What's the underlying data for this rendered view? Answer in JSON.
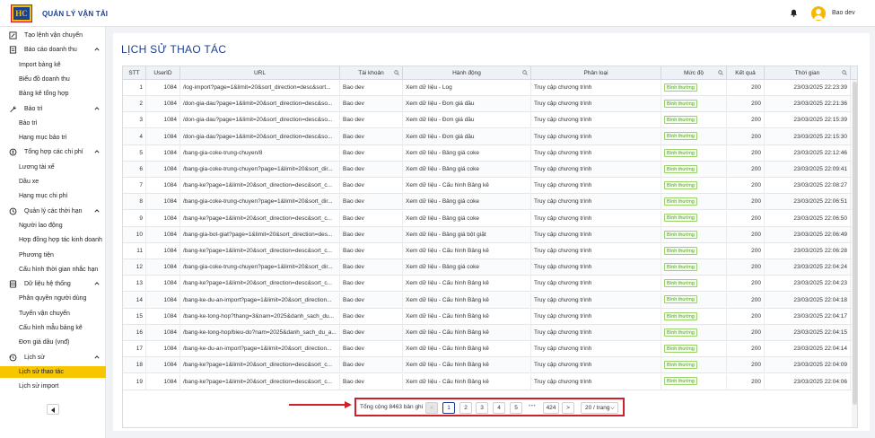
{
  "app": {
    "title": "QUẢN LÝ VẬN TẢI",
    "logo_text": "HC",
    "user_name": "Bao dev"
  },
  "sidebar": {
    "items": [
      {
        "type": "group",
        "label": "Tạo lệnh vận chuyển",
        "icon": "pencil-square-icon",
        "chevron": false
      },
      {
        "type": "group",
        "label": "Báo cáo doanh thu",
        "icon": "report-icon",
        "chevron": true
      },
      {
        "type": "item",
        "label": "Import bảng kê"
      },
      {
        "type": "item",
        "label": "Biểu đồ doanh thu"
      },
      {
        "type": "item",
        "label": "Bảng kê tổng hợp"
      },
      {
        "type": "group",
        "label": "Bảo trì",
        "icon": "wrench-icon",
        "chevron": true
      },
      {
        "type": "item",
        "label": "Bảo trì"
      },
      {
        "type": "item",
        "label": "Hạng mục bảo trì"
      },
      {
        "type": "group",
        "label": "Tổng hợp các chi phí",
        "icon": "coin-icon",
        "chevron": true
      },
      {
        "type": "item",
        "label": "Lương tài xế"
      },
      {
        "type": "item",
        "label": "Dầu xe"
      },
      {
        "type": "item",
        "label": "Hạng mục chi phí"
      },
      {
        "type": "group",
        "label": "Quản lý các thời hạn",
        "icon": "clock-icon",
        "chevron": true
      },
      {
        "type": "item",
        "label": "Người lao động"
      },
      {
        "type": "item",
        "label": "Hợp đồng hợp tác kinh doanh"
      },
      {
        "type": "item",
        "label": "Phương tiện"
      },
      {
        "type": "item",
        "label": "Cấu hình thời gian nhắc hạn"
      },
      {
        "type": "group",
        "label": "Dữ liệu hệ thống",
        "icon": "database-icon",
        "chevron": true
      },
      {
        "type": "item",
        "label": "Phân quyền người dùng"
      },
      {
        "type": "item",
        "label": "Tuyến vận chuyển"
      },
      {
        "type": "item",
        "label": "Cấu hình mẫu bảng kê"
      },
      {
        "type": "item",
        "label": "Đơn giá dầu (vnđ)"
      },
      {
        "type": "group",
        "label": "Lịch sử",
        "icon": "history-icon",
        "chevron": true
      },
      {
        "type": "item",
        "label": "Lịch sử thao tác",
        "active": true
      },
      {
        "type": "item",
        "label": "Lịch sử import"
      }
    ]
  },
  "page": {
    "title": "LỊCH SỬ THAO TÁC"
  },
  "table": {
    "columns": [
      {
        "label": "STT",
        "filter": false
      },
      {
        "label": "UserID",
        "filter": false
      },
      {
        "label": "URL",
        "filter": false
      },
      {
        "label": "Tài khoản",
        "filter": true
      },
      {
        "label": "Hành động",
        "filter": true
      },
      {
        "label": "Phân loại",
        "filter": false
      },
      {
        "label": "Mức độ",
        "filter": true
      },
      {
        "label": "Kết quả",
        "filter": false
      },
      {
        "label": "Thời gian",
        "filter": true
      }
    ],
    "badge_color": "#52a31e",
    "rows": [
      [
        "1",
        "1084",
        "/log-import?page=1&limit=20&sort_direction=desc&sort...",
        "Bao dev",
        "Xem dữ liệu - Log",
        "Truy cập chương trình",
        "Bình thường",
        "200",
        "23/03/2025 22:23:39"
      ],
      [
        "2",
        "1084",
        "/don-gia-dau?page=1&limit=20&sort_direction=desc&so...",
        "Bao dev",
        "Xem dữ liệu - Đơn giá dầu",
        "Truy cập chương trình",
        "Bình thường",
        "200",
        "23/03/2025 22:21:36"
      ],
      [
        "3",
        "1084",
        "/don-gia-dau?page=1&limit=20&sort_direction=desc&so...",
        "Bao dev",
        "Xem dữ liệu - Đơn giá dầu",
        "Truy cập chương trình",
        "Bình thường",
        "200",
        "23/03/2025 22:15:39"
      ],
      [
        "4",
        "1084",
        "/don-gia-dau?page=1&limit=20&sort_direction=desc&so...",
        "Bao dev",
        "Xem dữ liệu - Đơn giá dầu",
        "Truy cập chương trình",
        "Bình thường",
        "200",
        "23/03/2025 22:15:30"
      ],
      [
        "5",
        "1084",
        "/bang-gia-coke-trung-chuyen/8",
        "Bao dev",
        "Xem dữ liệu - Bảng giá coke",
        "Truy cập chương trình",
        "Bình thường",
        "200",
        "23/03/2025 22:12:46"
      ],
      [
        "6",
        "1084",
        "/bang-gia-coke-trung-chuyen?page=1&limit=20&sort_dir...",
        "Bao dev",
        "Xem dữ liệu - Bảng giá coke",
        "Truy cập chương trình",
        "Bình thường",
        "200",
        "23/03/2025 22:09:41"
      ],
      [
        "7",
        "1084",
        "/bang-ke?page=1&limit=20&sort_direction=desc&sort_c...",
        "Bao dev",
        "Xem dữ liệu - Cấu hình Bảng kê",
        "Truy cập chương trình",
        "Bình thường",
        "200",
        "23/03/2025 22:08:27"
      ],
      [
        "8",
        "1084",
        "/bang-gia-coke-trung-chuyen?page=1&limit=20&sort_dir...",
        "Bao dev",
        "Xem dữ liệu - Bảng giá coke",
        "Truy cập chương trình",
        "Bình thường",
        "200",
        "23/03/2025 22:06:51"
      ],
      [
        "9",
        "1084",
        "/bang-ke?page=1&limit=20&sort_direction=desc&sort_c...",
        "Bao dev",
        "Xem dữ liệu - Bảng giá coke",
        "Truy cập chương trình",
        "Bình thường",
        "200",
        "23/03/2025 22:06:50"
      ],
      [
        "10",
        "1084",
        "/bang-gia-bot-giat?page=1&limit=20&sort_direction=des...",
        "Bao dev",
        "Xem dữ liệu - Bảng giá bột giặt",
        "Truy cập chương trình",
        "Bình thường",
        "200",
        "23/03/2025 22:06:49"
      ],
      [
        "11",
        "1084",
        "/bang-ke?page=1&limit=20&sort_direction=desc&sort_c...",
        "Bao dev",
        "Xem dữ liệu - Cấu hình Bảng kê",
        "Truy cập chương trình",
        "Bình thường",
        "200",
        "23/03/2025 22:06:28"
      ],
      [
        "12",
        "1084",
        "/bang-gia-coke-trung-chuyen?page=1&limit=20&sort_dir...",
        "Bao dev",
        "Xem dữ liệu - Bảng giá coke",
        "Truy cập chương trình",
        "Bình thường",
        "200",
        "23/03/2025 22:04:24"
      ],
      [
        "13",
        "1084",
        "/bang-ke?page=1&limit=20&sort_direction=desc&sort_c...",
        "Bao dev",
        "Xem dữ liệu - Cấu hình Bảng kê",
        "Truy cập chương trình",
        "Bình thường",
        "200",
        "23/03/2025 22:04:23"
      ],
      [
        "14",
        "1084",
        "/bang-ke-du-an-import?page=1&limit=20&sort_direction...",
        "Bao dev",
        "Xem dữ liệu - Cấu hình Bảng kê",
        "Truy cập chương trình",
        "Bình thường",
        "200",
        "23/03/2025 22:04:18"
      ],
      [
        "15",
        "1084",
        "/bang-ke-tong-hop?thang=3&nam=2025&danh_sach_du...",
        "Bao dev",
        "Xem dữ liệu - Cấu hình Bảng kê",
        "Truy cập chương trình",
        "Bình thường",
        "200",
        "23/03/2025 22:04:17"
      ],
      [
        "16",
        "1084",
        "/bang-ke-tong-hop/bieu-do?nam=2025&danh_sach_du_a...",
        "Bao dev",
        "Xem dữ liệu - Cấu hình Bảng kê",
        "Truy cập chương trình",
        "Bình thường",
        "200",
        "23/03/2025 22:04:15"
      ],
      [
        "17",
        "1084",
        "/bang-ke-du-an-import?page=1&limit=20&sort_direction...",
        "Bao dev",
        "Xem dữ liệu - Cấu hình Bảng kê",
        "Truy cập chương trình",
        "Bình thường",
        "200",
        "23/03/2025 22:04:14"
      ],
      [
        "18",
        "1084",
        "/bang-ke?page=1&limit=20&sort_direction=desc&sort_c...",
        "Bao dev",
        "Xem dữ liệu - Cấu hình Bảng kê",
        "Truy cập chương trình",
        "Bình thường",
        "200",
        "23/03/2025 22:04:09"
      ],
      [
        "19",
        "1084",
        "/bang-ke?page=1&limit=20&sort_direction=desc&sort_c...",
        "Bao dev",
        "Xem dữ liệu - Cấu hình Bảng kê",
        "Truy cập chương trình",
        "Bình thường",
        "200",
        "23/03/2025 22:04:06"
      ]
    ]
  },
  "pagination": {
    "total_text": "Tổng cộng 8463 bản ghi",
    "prev_label": "<",
    "pages": [
      "1",
      "2",
      "3",
      "4",
      "5"
    ],
    "current_page": "1",
    "dots": "•••",
    "last_page": "424",
    "next_label": ">",
    "page_size_label": "20 / trang"
  },
  "annotation": {
    "color": "#d0202a"
  }
}
